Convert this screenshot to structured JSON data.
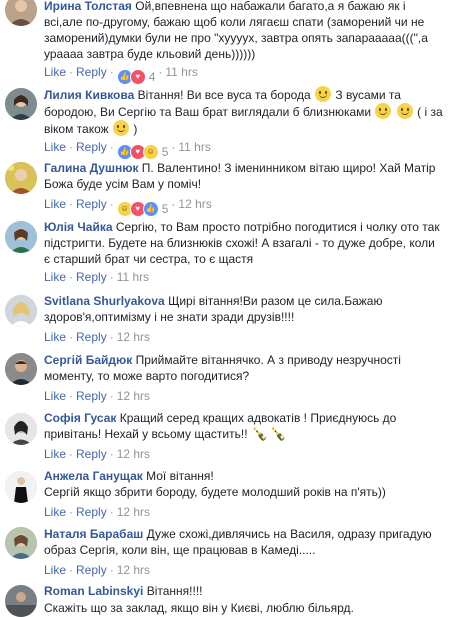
{
  "actions": {
    "like": "Like",
    "reply": "Reply",
    "dot": "·"
  },
  "colors": {
    "author": "#365899",
    "link": "#4267b2",
    "meta": "#90949c",
    "text": "#1d2129"
  },
  "comments": [
    {
      "author": "",
      "author_first_line": "Ирина Толстая",
      "text": "Ой,впевнена що набажали багато,а я бажаю як і всі,але по-другому, бажаю щоб коли лягаєш спати (заморений чи не заморений)думки були не про \"хууууx, завтра опять запарааааа(((\",а урааaa завтра буде кльовий день))))))",
      "reactions": [
        "like",
        "love"
      ],
      "reaction_count": "4",
      "time": "11 hrs",
      "avatar_icon": "user-avatar-icon"
    },
    {
      "author": "Лилия Кивкова",
      "text": "Вітання! Ви все вуса та борода",
      "text2": "З вусами та бородою, Ви Сергію та Ваш брат виглядали б близнюками",
      "text3": "( і за віком також",
      "text4": ")",
      "reactions": [
        "like",
        "love",
        "haha"
      ],
      "reaction_count": "5",
      "time": "11 hrs",
      "avatar_icon": "user-avatar-icon"
    },
    {
      "author": "Галина Душнюк",
      "text": "П. Валентино! З іменинником вітаю щиро! Хай Матір Божа буде усім Вам у поміч!",
      "reactions": [
        "haha",
        "love",
        "like"
      ],
      "reaction_count": "5",
      "time": "12 hrs",
      "avatar_icon": "user-avatar-icon"
    },
    {
      "author": "Юлія Чайка",
      "text": "Сергію, то Вам просто потрібно погодитися і чолку ото так підстригти. Будете на близнюків схожі! А взагалі - то дуже добре, коли є старший брат чи сестра, то є щастя",
      "reactions": [],
      "reaction_count": "",
      "time": "11 hrs",
      "avatar_icon": "user-avatar-icon"
    },
    {
      "author": "Svitlana Shurlyakova",
      "text": "Щирі вітання!Ви разом це сила.Бажаю здоров'я,оптимізму і не знати зради друзів!!!!",
      "reactions": [],
      "reaction_count": "",
      "time": "12 hrs",
      "avatar_icon": "user-avatar-icon"
    },
    {
      "author": "Сергій Байдюк",
      "text": "Приймайте вітаннячко. А з приводу незручності моменту, то може варто погодитися?",
      "reactions": [],
      "reaction_count": "",
      "time": "12 hrs",
      "avatar_icon": "user-avatar-icon"
    },
    {
      "author": "Софія Гусак",
      "text": "Кращий серед кращих адвокатів ! Приєднуюсь до привітань! Нехай у всьому щастить!!",
      "reactions": [],
      "reaction_count": "",
      "time": "12 hrs",
      "avatar_icon": "user-avatar-icon"
    },
    {
      "author": "Анжела Ганущак",
      "text": "Мої вітання!\nСергій якщо збрити бороду, будете молодший років на п'ять))",
      "reactions": [],
      "reaction_count": "",
      "time": "12 hrs",
      "avatar_icon": "user-avatar-icon"
    },
    {
      "author": "Наталя Барабаш",
      "text": "Дуже схожі,дивлячись на Василя, одразу пригадую образ Сергія, коли він, ще працював в Камеді.....",
      "reactions": [],
      "reaction_count": "",
      "time": "12 hrs",
      "avatar_icon": "user-avatar-icon"
    },
    {
      "author": "Roman Labinskyi",
      "text": "Вітання!!!!",
      "reactions": [],
      "reaction_count": "",
      "time": "12 hrs",
      "avatar_icon": "user-avatar-icon"
    }
  ],
  "partial_last": {
    "text": "Скажіть що за заклад, якщо він у Києві, люблю більярд."
  }
}
